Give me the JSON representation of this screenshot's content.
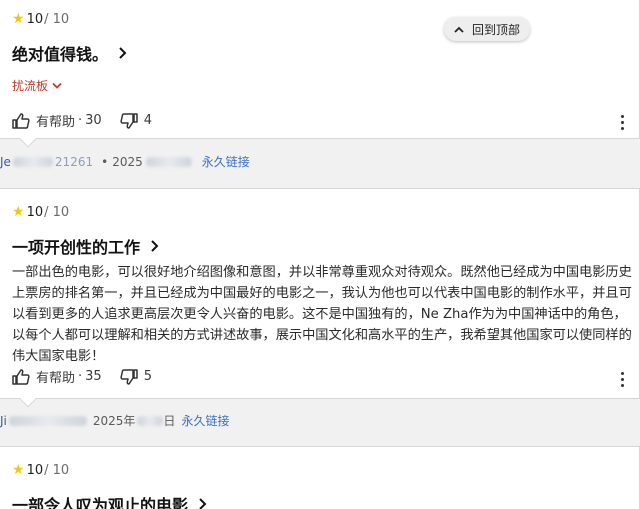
{
  "back_to_top": "回到顶部",
  "reviews": [
    {
      "score": "10",
      "out_of": "/ 10",
      "title": "绝对值得钱。",
      "spoiler_label": "扰流板",
      "helpful_label": "有帮助",
      "helpful_count": "30",
      "not_helpful_count": "4",
      "user_prefix": "Je",
      "user_suffix": "21261",
      "date_prefix": "2025",
      "permalink": "永久链接"
    },
    {
      "score": "10",
      "out_of": "/ 10",
      "title": "一项开创性的工作",
      "body": "一部出色的电影，可以很好地介绍图像和意图，并以非常尊重观众对待观众。既然他已经成为中国电影历史上票房的排名第一，并且已经成为中国最好的电影之一，我认为他也可以代表中国电影的制作水平，并且可以看到更多的人追求更高层次更令人兴奋的电影。这不是中国独有的，Ne Zha作为为中国神话中的角色，以每个人都可以理解和相关的方式讲述故事，展示中国文化和高水平的生产，我希望其他国家可以使同样的伟大国家电影！",
      "helpful_label": "有帮助",
      "helpful_count": "35",
      "not_helpful_count": "5",
      "user_prefix": "Ji",
      "date_text": "2025年",
      "date_suffix": "日",
      "permalink": "永久链接"
    },
    {
      "score": "10",
      "out_of": "/ 10",
      "title": "一部令人叹为观止的电影"
    }
  ],
  "colors": {
    "star": "#f5c518",
    "spoiler": "#c0392b",
    "link": "#3b6fc4"
  }
}
